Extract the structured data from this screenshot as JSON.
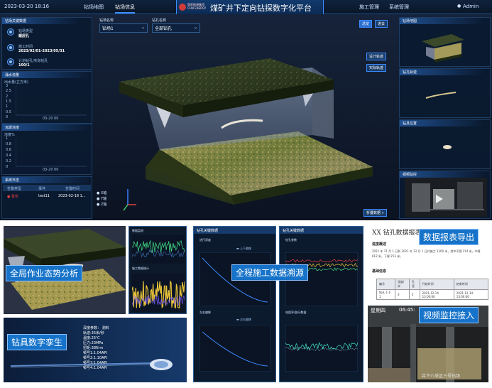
{
  "topbar": {
    "datetime": "2023-03-20 18:16",
    "nav_left": [
      "钻场地图",
      "钻场信息"
    ],
    "brand_line1": "国家能源集团",
    "brand_line2": "CHN ENERGY",
    "title": "煤矿井下定向钻探数字化平台",
    "nav_right": [
      "施工管理",
      "系统管理"
    ],
    "user": "Admin"
  },
  "left_panels": {
    "key_data_title": "钻场关键数据",
    "key_items": [
      {
        "label": "钻场类型",
        "value": "顺层孔"
      },
      {
        "label": "施工时间",
        "value": "2023/02/01-2023/05/31"
      },
      {
        "label": "计划钻孔/实际钻孔",
        "value": "100/1"
      }
    ],
    "water_title": "涌水流量",
    "water_unit": "出水量(立方米)",
    "water_yticks": [
      "3",
      "2.5",
      "2",
      "1.5",
      "1",
      "0.5",
      "0"
    ],
    "water_xtick": "03-20 00",
    "gas_title": "瓦斯浓度",
    "gas_unit": "浓度%",
    "gas_yticks": [
      "1",
      "0.8",
      "0.6",
      "0.4",
      "0.2",
      "0"
    ],
    "gas_xtick": "03-20 00",
    "log_title": "系统日志",
    "log_headers": [
      "告警类型",
      "事件",
      "告警时间"
    ],
    "log_row": {
      "type": "警告",
      "event": "test11",
      "time": "2023-02-18 1..."
    }
  },
  "selectors": {
    "field_label": "钻场名称",
    "field_value": "钻场1",
    "hole_label": "钻孔名称",
    "hole_value": "全部钻孔"
  },
  "view_buttons": {
    "overview": "总览",
    "inside": "进去",
    "design": "设计轨迹",
    "actual": "实际轨迹",
    "fold": "折叠数据"
  },
  "axes": {
    "x": "X轴",
    "y": "Y轴",
    "z": "Z轴"
  },
  "right_panels": {
    "p1": "钻场地图",
    "p2": "钻孔轨迹",
    "p3": "钻具位置",
    "p4": "视频监控"
  },
  "bottom": {
    "cap1": "全局作业态势分析",
    "cap2": "钻具数字孪生",
    "cap3": "全程施工数据溯源",
    "cap4": "数据报表导出",
    "cap5": "视频监控接入",
    "drill_readout": [
      "深度参数： 测料",
      "轨迹:35米/秒",
      "温度:25℃",
      "压力:23MPa",
      "扭矩:38N·m",
      "顿号1:1.04API",
      "顿号2:1.10API",
      "顿号3:1.04API",
      "顿号4:1.04API"
    ],
    "chart1_title": "钻孔关键数据",
    "chart1_sub": "进尺深度",
    "chart1_legend": "上下偏移",
    "chart1b_sub": "左右偏移",
    "chart1b_legend": "左右偏移",
    "chart2_title": "钻孔关键数据",
    "chart2_sub": "钻孔参数",
    "chart2b_sub": "电阻率/伽马数据",
    "mini_top": "数据监测",
    "mini_bottom": "施工数据统计",
    "report_title": "XX 钻孔数据报表",
    "report_sec1": "进度概述",
    "report_para": "2021 年 11 月 1 日到 2021 年 12 月 1 日共施工 1300 米，其中平煤 214 米，中煤 612 米，下煤 253 米。",
    "report_sec2": "基础信息",
    "report_headers": [
      "编号",
      "深度/米",
      "孔径",
      "开始时间",
      "结束时间"
    ],
    "report_row": [
      "钻孔 1-1-1",
      "3",
      "5",
      "2021-12-14 13:00:00",
      "2021-12-14 13:00:00"
    ],
    "video_label": "星期四",
    "video_time": "06:45:",
    "video_watermark": "井下八采区三号钻场"
  },
  "colors": {
    "accent": "#1673c9",
    "panel": "#0a1a30",
    "warn": "#e04040"
  }
}
